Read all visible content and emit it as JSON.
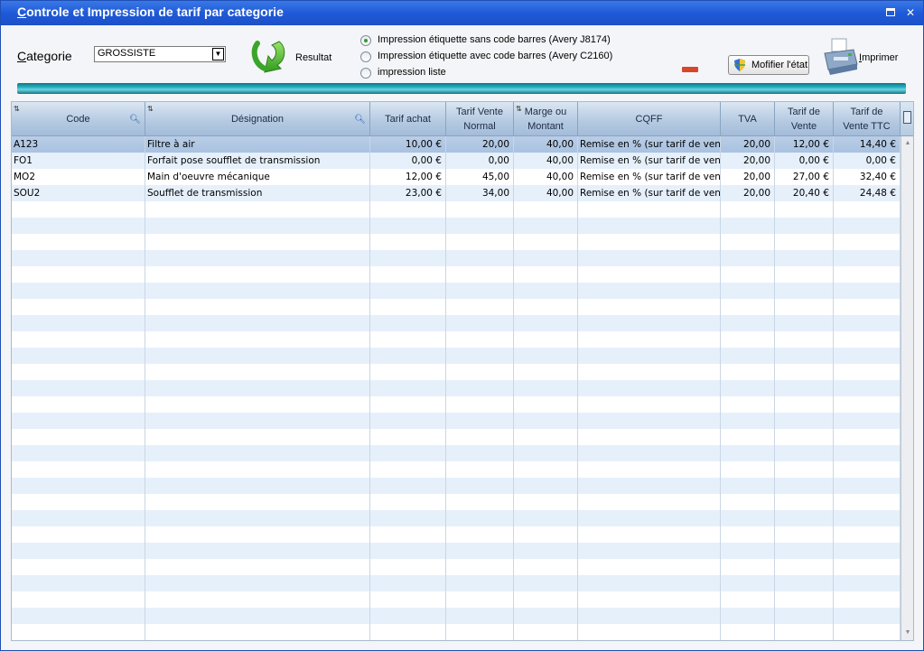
{
  "window": {
    "title_first_letter": "C",
    "title_rest": "ontrole et Impression de tarif par categorie"
  },
  "toolbar": {
    "categorie_label_u": "C",
    "categorie_label_rest": "ategorie",
    "categorie_value": "GROSSISTE",
    "result_label": "Resultat",
    "radios": [
      {
        "label": "Impression étiquette sans code barres (Avery J8174)",
        "selected": true
      },
      {
        "label": "Impression étiquette avec code barres  (Avery C2160)",
        "selected": false
      },
      {
        "label": "impression liste",
        "selected": false
      }
    ],
    "modify_label": "Mofifier l'état",
    "print_label_u": "I",
    "print_label_rest": "mprimer"
  },
  "table": {
    "headers": {
      "code": "Code",
      "designation": "Désignation",
      "tarif_achat": "Tarif achat",
      "tarif_vente_normal_1": "Tarif Vente",
      "tarif_vente_normal_2": "Normal",
      "marge_1": "Marge ou",
      "marge_2": "Montant",
      "cqff": "CQFF",
      "tva": "TVA",
      "tarif_vente_1": "Tarif de",
      "tarif_vente_2": "Vente",
      "tarif_ttc_1": "Tarif de",
      "tarif_ttc_2": "Vente TTC"
    },
    "rows": [
      {
        "code": "A123",
        "designation": "Filtre à air",
        "tarif_achat": "10,00 €",
        "tarif_vente_normal": "20,00",
        "marge": "40,00",
        "cqff": "Remise en % (sur tarif de vente",
        "tva": "20,00",
        "tarif_vente": "12,00 €",
        "tarif_ttc": "14,40 €"
      },
      {
        "code": "FO1",
        "designation": "Forfait pose soufflet de transmission",
        "tarif_achat": "0,00 €",
        "tarif_vente_normal": "0,00",
        "marge": "40,00",
        "cqff": "Remise en % (sur tarif de vente",
        "tva": "20,00",
        "tarif_vente": "0,00 €",
        "tarif_ttc": "0,00 €"
      },
      {
        "code": "MO2",
        "designation": "Main d'oeuvre mécanique",
        "tarif_achat": "12,00 €",
        "tarif_vente_normal": "45,00",
        "marge": "40,00",
        "cqff": "Remise en % (sur tarif de vente",
        "tva": "20,00",
        "tarif_vente": "27,00 €",
        "tarif_ttc": "32,40 €"
      },
      {
        "code": "SOU2",
        "designation": "Soufflet de transmission",
        "tarif_achat": "23,00 €",
        "tarif_vente_normal": "34,00",
        "marge": "40,00",
        "cqff": "Remise en % (sur tarif de vente",
        "tva": "20,00",
        "tarif_vente": "20,40 €",
        "tarif_ttc": "24,48 €"
      }
    ],
    "selected_row": 0
  },
  "colors": {
    "titlebar": "#1f5ad8",
    "teal_bar": "#2bb3c6",
    "row_alt": "#e6f0fb",
    "row_selected": "#b1c8e3"
  }
}
